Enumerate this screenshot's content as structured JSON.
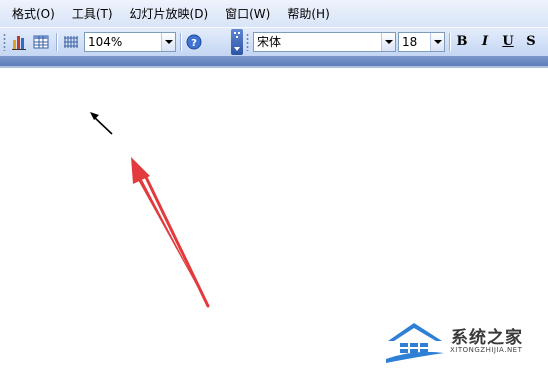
{
  "menu": {
    "items": [
      "格式(O)",
      "工具(T)",
      "幻灯片放映(D)",
      "窗口(W)",
      "帮助(H)"
    ]
  },
  "toolbar": {
    "zoom_value": "104%",
    "font_name": "宋体",
    "font_size": "18",
    "bold_label": "B",
    "italic_label": "I",
    "underline_label": "U",
    "shadow_label": "S"
  },
  "watermark": {
    "title": "系统之家",
    "url": "XITONGZHIJIA.NET"
  },
  "icons": [
    "chart-icon",
    "table-icon",
    "grid-icon",
    "help-icon",
    "toolbar-options-icon"
  ],
  "colors": {
    "red_arrow": "#e33a3d",
    "watermark_blue": "#2f7fd6"
  }
}
